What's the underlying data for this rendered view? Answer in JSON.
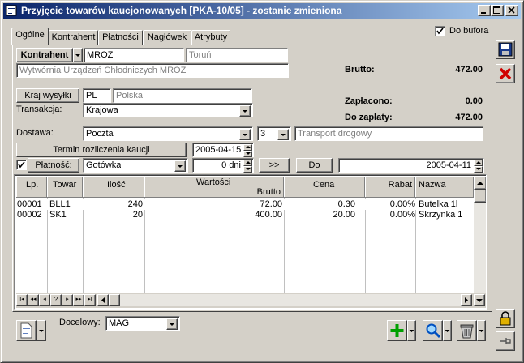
{
  "window": {
    "title": "Przyjęcie towarów kaucjonowanych [PKA-10/05]  - zostanie zmieniona"
  },
  "tabs": [
    {
      "label": "Ogólne"
    },
    {
      "label": "Kontrahent"
    },
    {
      "label": "Płatności"
    },
    {
      "label": "Nagłówek"
    },
    {
      "label": "Atrybuty"
    }
  ],
  "do_bufora": {
    "label": "Do bufora",
    "checked": true
  },
  "kontrahent": {
    "button": "Kontrahent",
    "code": "MROZ",
    "city": "Toruń",
    "name": "Wytwórnia Urządzeń Chłodniczych MROZ"
  },
  "kraj": {
    "button": "Kraj wysyłki",
    "code": "PL",
    "name": "Polska"
  },
  "transakcja": {
    "label": "Transakcja:",
    "value": "Krajowa"
  },
  "dostawa": {
    "label": "Dostawa:",
    "value": "Poczta",
    "number": "3",
    "transport": "Transport drogowy"
  },
  "termin": {
    "button": "Termin rozliczenia kaucji",
    "date": "2005-04-15"
  },
  "platnosc": {
    "label": "Płatność:",
    "checked": true,
    "value": "Gotówka",
    "days": "0 dni",
    "arrow_button": ">>",
    "do_button": "Do",
    "due_date": "2005-04-11"
  },
  "totals": {
    "brutto_label": "Brutto:",
    "brutto_value": "472.00",
    "zaplacono_label": "Zapłacono:",
    "zaplacono_value": "0.00",
    "do_zaplaty_label": "Do zapłaty:",
    "do_zaplaty_value": "472.00"
  },
  "grid": {
    "headers": {
      "lp": "Lp.",
      "towar": "Towar",
      "ilosc": "Ilość",
      "wartosci": "Wartości",
      "brutto": "Brutto",
      "cena": "Cena",
      "rabat": "Rabat",
      "nazwa": "Nazwa"
    },
    "rows": [
      {
        "lp": "00001",
        "towar": "BLL1",
        "ilosc": "240",
        "brutto": "72.00",
        "cena": "0.30",
        "rabat": "0.00%",
        "nazwa": "Butelka 1l"
      },
      {
        "lp": "00002",
        "towar": "SK1",
        "ilosc": "20",
        "brutto": "400.00",
        "cena": "20.00",
        "rabat": "0.00%",
        "nazwa": "Skrzynka 1"
      }
    ],
    "nav_labels": [
      "I◂",
      "◂◂",
      "◂",
      "?",
      "▸",
      "▸▸",
      "▸I"
    ]
  },
  "bottom": {
    "docelowy_label": "Docelowy:",
    "docelowy_value": "MAG"
  },
  "icons": {
    "save": "save-disk-icon",
    "cancel": "red-x-icon",
    "add": "green-plus-icon",
    "search": "magnifier-icon",
    "delete": "trash-can-icon",
    "lock": "padlock-icon",
    "pin": "pin-icon"
  }
}
